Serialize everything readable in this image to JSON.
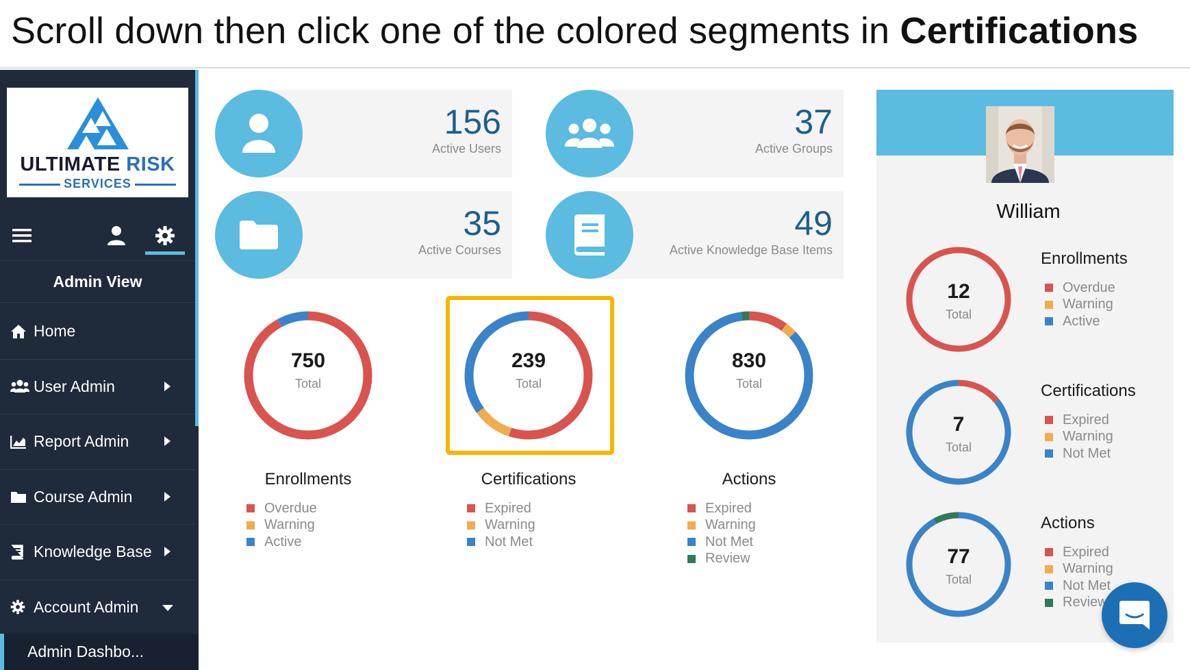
{
  "instruction": {
    "prefix": "Scroll down then click one of the colored segments in ",
    "emphasis": "Certifications"
  },
  "colors": {
    "red": "#d9534f",
    "orange": "#f0ad4e",
    "blue": "#3a83c9",
    "green": "#2f7a5a",
    "accent": "#5bbbe0",
    "sidebar": "#1f2a3a",
    "highlight": "#f7b500"
  },
  "logo": {
    "main_a": "ULTIMATE",
    "main_b": "RISK",
    "sub": "SERVICES"
  },
  "sidebar": {
    "icons": [
      "menu-icon",
      "user-icon",
      "gear-icon"
    ],
    "view_label": "Admin View",
    "items": [
      {
        "label": "Home",
        "icon": "home-icon"
      },
      {
        "label": "User Admin",
        "icon": "users-icon"
      },
      {
        "label": "Report Admin",
        "icon": "chart-icon"
      },
      {
        "label": "Course Admin",
        "icon": "folder-icon"
      },
      {
        "label": "Knowledge Base",
        "icon": "book-icon"
      },
      {
        "label": "Account Admin",
        "icon": "gear-icon"
      }
    ],
    "sub_item": "Admin Dashbo..."
  },
  "stats": [
    {
      "value": "156",
      "label": "Active Users",
      "icon": "user-icon"
    },
    {
      "value": "37",
      "label": "Active Groups",
      "icon": "group-icon"
    },
    {
      "value": "35",
      "label": "Active Courses",
      "icon": "folder-icon"
    },
    {
      "value": "49",
      "label": "Active Knowledge Base Items",
      "icon": "book-icon"
    }
  ],
  "charts": [
    {
      "title": "Enrollments",
      "total": "750",
      "total_label": "Total",
      "legend": [
        "Overdue",
        "Warning",
        "Active"
      ],
      "segments": [
        0.92,
        0.0,
        0.08
      ]
    },
    {
      "title": "Certifications",
      "total": "239",
      "total_label": "Total",
      "legend": [
        "Expired",
        "Warning",
        "Not Met"
      ],
      "segments": [
        0.55,
        0.1,
        0.35
      ]
    },
    {
      "title": "Actions",
      "total": "830",
      "total_label": "Total",
      "legend": [
        "Expired",
        "Warning",
        "Not Met",
        "Review"
      ],
      "segments": [
        0.1,
        0.03,
        0.85,
        0.02
      ]
    }
  ],
  "profile": {
    "name": "William",
    "charts": [
      {
        "title": "Enrollments",
        "total": "12",
        "total_label": "Total",
        "legend": [
          "Overdue",
          "Warning",
          "Active"
        ],
        "segments": [
          1.0,
          0.0,
          0.0
        ]
      },
      {
        "title": "Certifications",
        "total": "7",
        "total_label": "Total",
        "legend": [
          "Expired",
          "Warning",
          "Not Met"
        ],
        "segments": [
          0.14,
          0.0,
          0.86
        ]
      },
      {
        "title": "Actions",
        "total": "77",
        "total_label": "Total",
        "legend": [
          "Expired",
          "Warning",
          "Not Met",
          "Review"
        ],
        "segments": [
          0.0,
          0.0,
          0.92,
          0.08
        ]
      }
    ]
  }
}
